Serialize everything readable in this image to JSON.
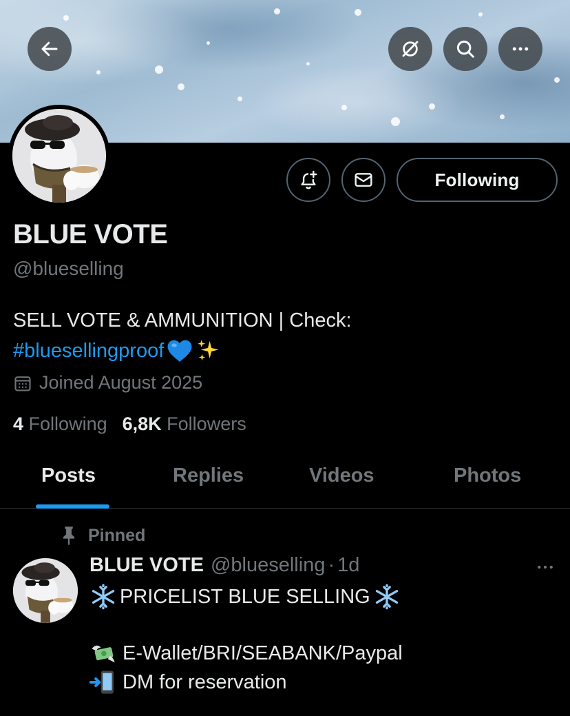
{
  "profile": {
    "display_name": "BLUE VOTE",
    "handle": "@blueselling",
    "bio_text": "SELL VOTE & AMMUNITION | Check:",
    "bio_hashtag": "#bluesellingproof",
    "joined": "Joined August 2025",
    "following_count": "4",
    "following_label": "Following",
    "followers_count": "6,8K",
    "followers_label": "Followers",
    "follow_button_label": "Following"
  },
  "tabs": [
    {
      "label": "Posts",
      "active": true
    },
    {
      "label": "Replies",
      "active": false
    },
    {
      "label": "Videos",
      "active": false
    },
    {
      "label": "Photos",
      "active": false
    }
  ],
  "pinned_post": {
    "pinned_label": "Pinned",
    "author_name": "BLUE VOTE",
    "author_handle": "@blueselling",
    "separator": "·",
    "time": "1d",
    "title": "PRICELIST BLUE SELLING",
    "line_payment": "E-Wallet/BRI/SEABANK/Paypal",
    "line_dm": "DM for reservation"
  },
  "icons": {
    "back": "arrow-left-icon",
    "grok": "grok-icon",
    "search": "search-icon",
    "more": "more-horizontal-icon",
    "notify": "bell-plus-icon",
    "message": "envelope-icon",
    "calendar": "calendar-icon",
    "pin": "pin-icon",
    "snowflake": "snowflake-emoji",
    "money": "money-wings-emoji",
    "phone": "mobile-arrow-emoji",
    "heart": "blue-heart-emoji",
    "sparkles": "sparkles-emoji"
  },
  "colors": {
    "background": "#000000",
    "accent": "#1d9bf0",
    "secondary_text": "#71767b",
    "primary_text": "#e7e9ea",
    "border": "#536471"
  }
}
